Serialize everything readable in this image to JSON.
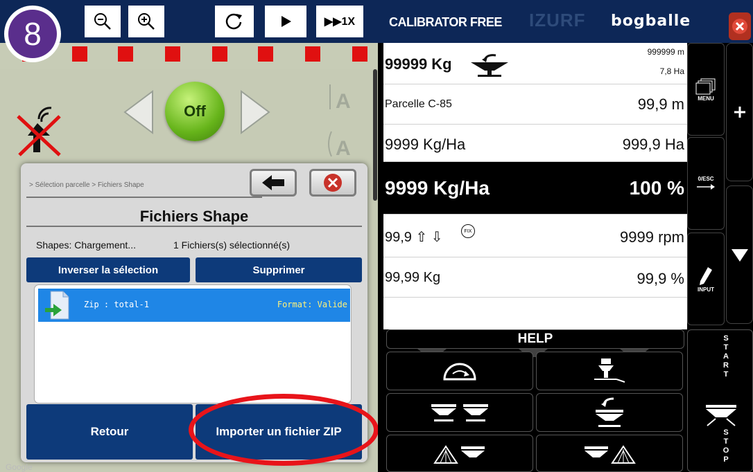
{
  "step_number": "8",
  "toolbar": {
    "zoom_out": "zoom-out-icon",
    "zoom_in": "zoom-in-icon",
    "refresh": "refresh-icon",
    "play": "play-icon",
    "speed_label": "▶▶1X"
  },
  "map": {
    "off_label": "Off",
    "google_label": "Google",
    "red_markers": 10
  },
  "dialog": {
    "breadcrumb": "> Sélection parcelle > Fichiers Shape",
    "title": "Fichiers Shape",
    "status_left": "Shapes: Chargement...",
    "status_right": "1 Fichiers(s) sélectionné(s)",
    "invert_label": "Inverser la sélection",
    "delete_label": "Supprimer",
    "files": [
      {
        "name": "Zip  : total-1",
        "format": "Format: Valide"
      }
    ],
    "back_label": "Retour",
    "import_label": "Importer un fichier ZIP"
  },
  "calibrator": {
    "title": "CALIBRATOR FREE",
    "watermark": "IZURF",
    "brand": "bogballe",
    "rows": [
      {
        "left": "99999 Kg",
        "right_top": "999999 m",
        "right_bottom": "7,8 Ha"
      },
      {
        "left": "Parcelle C-85",
        "right": "99,9 m"
      },
      {
        "left": "9999 Kg/Ha",
        "right": "999,9 Ha"
      },
      {
        "left": "9999 Kg/Ha",
        "right": "100 %"
      },
      {
        "left": "99,9 ⇧ ⇩",
        "badge": "FIX",
        "right": "9999 rpm"
      },
      {
        "left": "99,99 Kg",
        "right": "99,9 %"
      }
    ],
    "menu_label": "MENU",
    "esc_label": "0/ESC",
    "input_label": "INPUT",
    "help_label": "HELP",
    "start_letters": [
      "S",
      "T",
      "A",
      "R",
      "T"
    ],
    "stop_letters": [
      "S",
      "T",
      "O",
      "P"
    ]
  },
  "colors": {
    "navy": "#0d2757",
    "button_blue": "#0d3a7a",
    "selection_blue": "#1f86e6",
    "highlight_red": "#e8141a"
  }
}
